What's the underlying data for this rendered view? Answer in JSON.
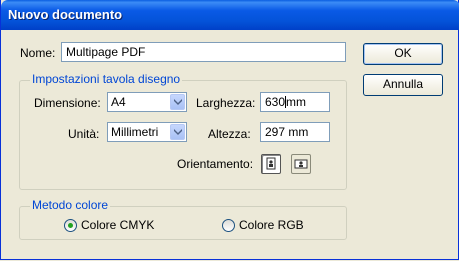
{
  "window": {
    "title": "Nuovo documento"
  },
  "name_field": {
    "label": "Nome:",
    "value": "Multipage PDF"
  },
  "buttons": {
    "ok": "OK",
    "cancel": "Annulla"
  },
  "page_settings": {
    "group_title": "Impostazioni tavola disegno",
    "size": {
      "label": "Dimensione:",
      "value": "A4"
    },
    "units": {
      "label": "Unità:",
      "value": "Millimetri"
    },
    "width": {
      "label": "Larghezza:",
      "value": "630",
      "unit": "mm"
    },
    "height": {
      "label": "Altezza:",
      "value": "297",
      "unit": "mm"
    },
    "orientation": {
      "label": "Orientamento:",
      "selected": "portrait"
    }
  },
  "color_mode": {
    "group_title": "Metodo colore",
    "options": [
      {
        "label": "Colore CMYK",
        "selected": true
      },
      {
        "label": "Colore RGB",
        "selected": false
      }
    ]
  },
  "icons": [
    "chevron-down-icon",
    "portrait-orientation-icon",
    "landscape-orientation-icon"
  ]
}
